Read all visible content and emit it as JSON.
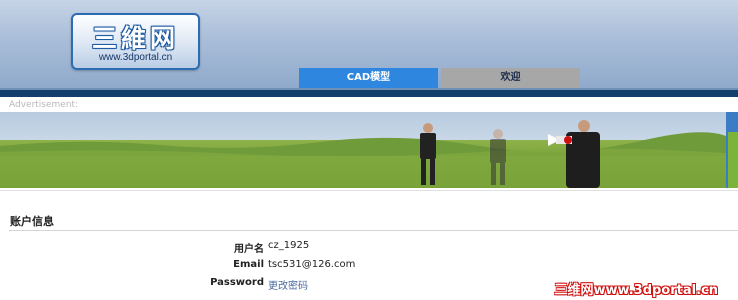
{
  "logo": {
    "main": "三維网",
    "sub": "www.3dportal.cn"
  },
  "tabs": [
    {
      "label": "CAD模型",
      "active": true
    },
    {
      "label": "欢迎",
      "active": false
    }
  ],
  "ad_label": "Advertisement:",
  "account": {
    "title": "账户信息",
    "fields": [
      {
        "label": "用户名",
        "value": "cz_1925"
      },
      {
        "label": "Email",
        "value": "tsc531@126.com"
      },
      {
        "label": "Password",
        "value": "更改密码"
      }
    ]
  },
  "watermark": "三维网www.3dportal.cn",
  "colors": {
    "active_tab": "#2e86de",
    "inactive_tab": "#a7a7a7",
    "navbar": "#123f6b",
    "link": "#4a6a9c"
  }
}
